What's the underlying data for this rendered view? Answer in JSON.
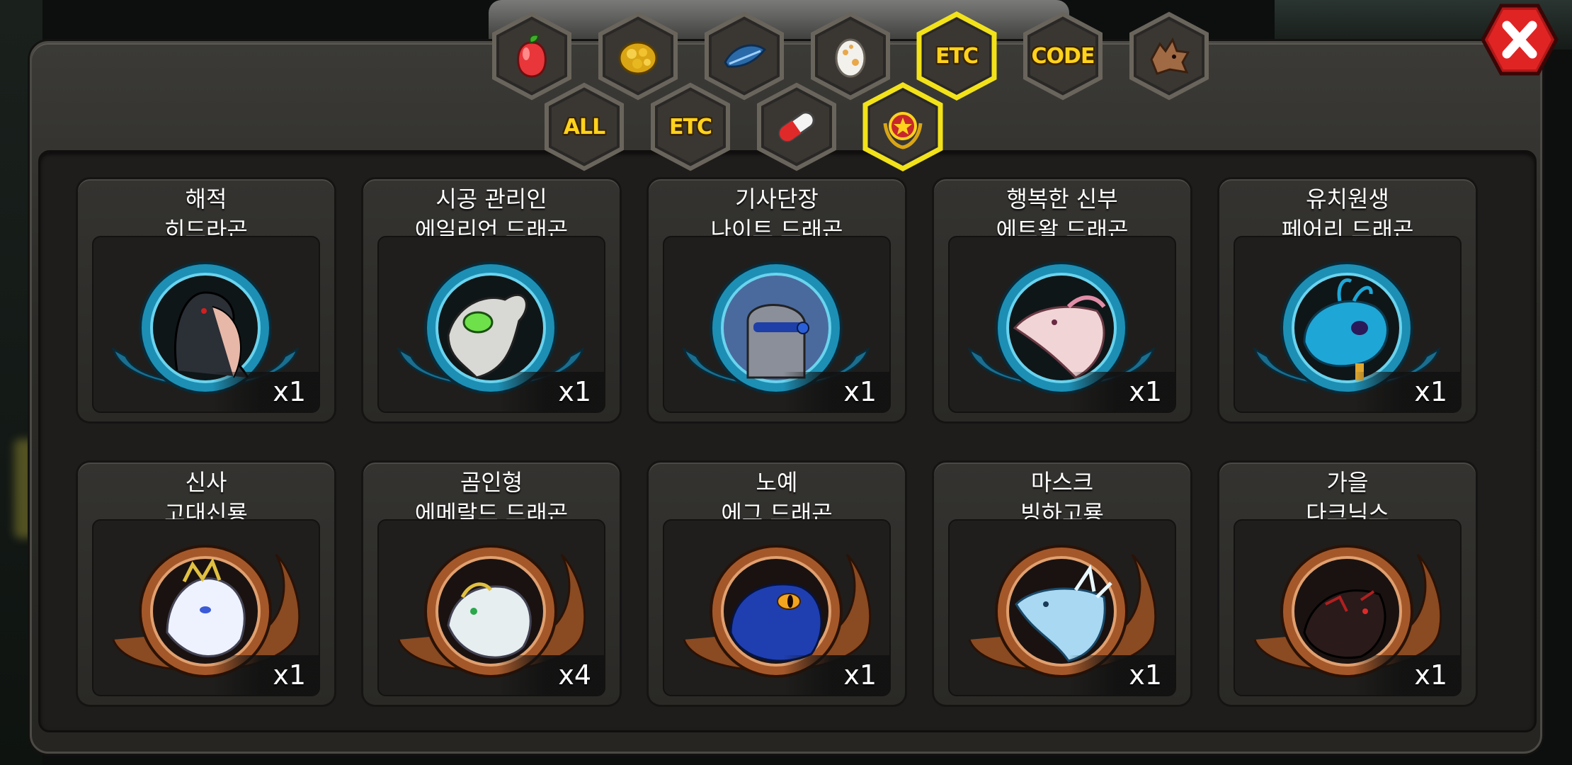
{
  "category_tabs": [
    {
      "id": "fruit",
      "icon": "red-fruit-icon"
    },
    {
      "id": "gold",
      "icon": "gold-ore-icon"
    },
    {
      "id": "feather",
      "icon": "blue-feather-icon"
    },
    {
      "id": "egg",
      "icon": "egg-icon"
    },
    {
      "id": "etc",
      "label": "ETC",
      "selected": true
    },
    {
      "id": "code",
      "label": "CODE"
    },
    {
      "id": "dragon",
      "icon": "dragon-head-icon"
    }
  ],
  "sub_tabs": [
    {
      "id": "all",
      "label": "ALL"
    },
    {
      "id": "etc2",
      "label": "ETC"
    },
    {
      "id": "capsule",
      "icon": "capsule-icon"
    },
    {
      "id": "badge",
      "icon": "star-emblem-icon",
      "selected": true
    }
  ],
  "items": [
    {
      "line1": "해적",
      "line2": "히드라곤",
      "qty": "x1",
      "frame": "blue",
      "portrait": "hydra-portrait",
      "color": "#2b2f36"
    },
    {
      "line1": "시공 관리인",
      "line2": "에일리언 드래곤",
      "qty": "x1",
      "frame": "blue",
      "portrait": "alien-dragon-portrait",
      "color": "#d8d8d4"
    },
    {
      "line1": "기사단장",
      "line2": "나이트 드래곤",
      "qty": "x1",
      "frame": "blue",
      "portrait": "knight-dragon-portrait",
      "color": "#8a8f99"
    },
    {
      "line1": "행복한 신부",
      "line2": "에트왈 드래곤",
      "qty": "x1",
      "frame": "blue",
      "portrait": "etoile-dragon-portrait",
      "color": "#f1d4d6"
    },
    {
      "line1": "유치원생",
      "line2": "페어리 드래곤",
      "qty": "x1",
      "frame": "blue",
      "portrait": "fairy-dragon-portrait",
      "color": "#1ea6d6"
    },
    {
      "line1": "신사",
      "line2": "고대신룡",
      "qty": "x1",
      "frame": "bronze",
      "portrait": "ancient-dragon-portrait",
      "color": "#eef2ff"
    },
    {
      "line1": "곰인형",
      "line2": "에메랄드 드래곤",
      "qty": "x4",
      "frame": "bronze",
      "portrait": "emerald-dragon-portrait",
      "color": "#e7eef0"
    },
    {
      "line1": "노예",
      "line2": "에그 드래곤",
      "qty": "x1",
      "frame": "bronze",
      "portrait": "egg-dragon-portrait",
      "color": "#1f3fb0"
    },
    {
      "line1": "마스크",
      "line2": "빙하고룡",
      "qty": "x1",
      "frame": "bronze",
      "portrait": "glacier-dragon-portrait",
      "color": "#a9d9f2"
    },
    {
      "line1": "가을",
      "line2": "다크닉스",
      "qty": "x1",
      "frame": "bronze",
      "portrait": "darknix-portrait",
      "color": "#2a1a1a"
    }
  ],
  "colors": {
    "tab_label": "#ffd21e",
    "selected_border": "#f2e21a",
    "close": "#d62020"
  }
}
